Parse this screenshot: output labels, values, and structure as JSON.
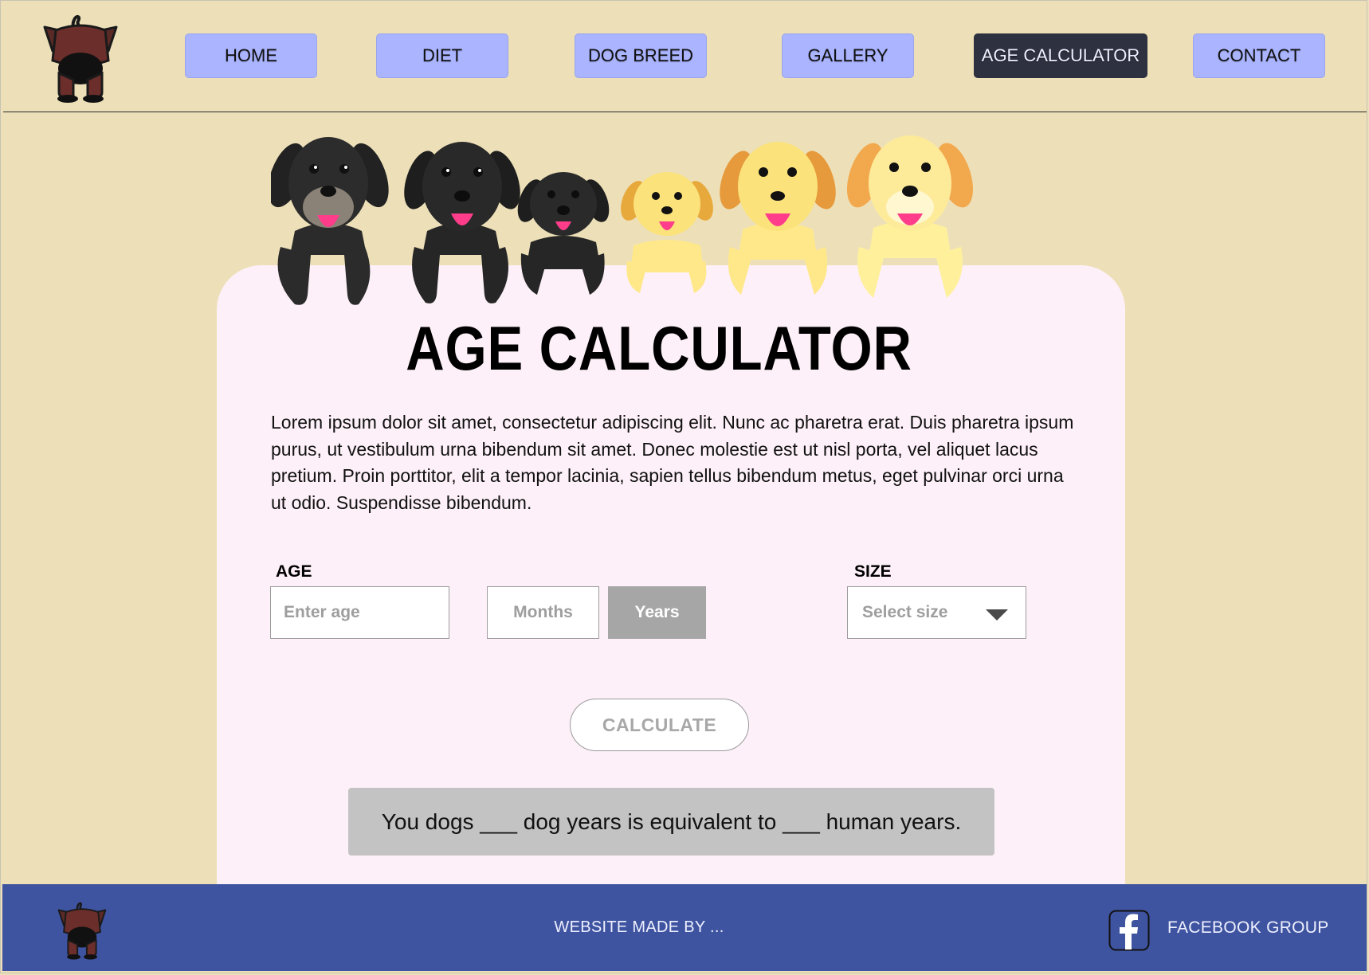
{
  "nav": {
    "items": [
      {
        "label": "HOME",
        "active": false
      },
      {
        "label": "DIET",
        "active": false
      },
      {
        "label": "DOG BREED",
        "active": false
      },
      {
        "label": "GALLERY",
        "active": false
      },
      {
        "label": "AGE CALCULATOR",
        "active": true
      },
      {
        "label": "CONTACT",
        "active": false
      }
    ]
  },
  "logo": {
    "icon": "dog-logo-icon"
  },
  "hero": {
    "icon": "six-puppies-illustration"
  },
  "main": {
    "title": "AGE CALCULATOR",
    "description": "Lorem ipsum dolor sit amet, consectetur adipiscing elit. Nunc ac pharetra erat. Duis pharetra ipsum purus, ut vestibulum urna bibendum sit amet. Donec molestie est ut nisl porta, vel aliquet lacus pretium. Proin porttitor, elit a tempor lacinia, sapien tellus bibendum metus, eget pulvinar orci urna ut odio. Suspendisse bibendum."
  },
  "form": {
    "age_label": "AGE",
    "age_placeholder": "Enter age",
    "age_value": "",
    "unit_options": [
      "Months",
      "Years"
    ],
    "unit_selected": "Years",
    "size_label": "SIZE",
    "size_placeholder": "Select size",
    "calculate_label": "CALCULATE"
  },
  "result": {
    "text": "You dogs ___ dog years is equivalent to ___ human years."
  },
  "footer": {
    "credit": "WEBSITE MADE BY ...",
    "facebook_label": "FACEBOOK GROUP",
    "facebook_icon": "facebook-icon"
  },
  "colors": {
    "page_bg": "#ede0b8",
    "nav_button": "#aab4ff",
    "nav_active": "#2e313f",
    "card_bg": "#fdf0f8",
    "years_selected": "#a6a6a6",
    "result_bg": "#c3c3c3",
    "footer_bg": "#3f54a0"
  }
}
